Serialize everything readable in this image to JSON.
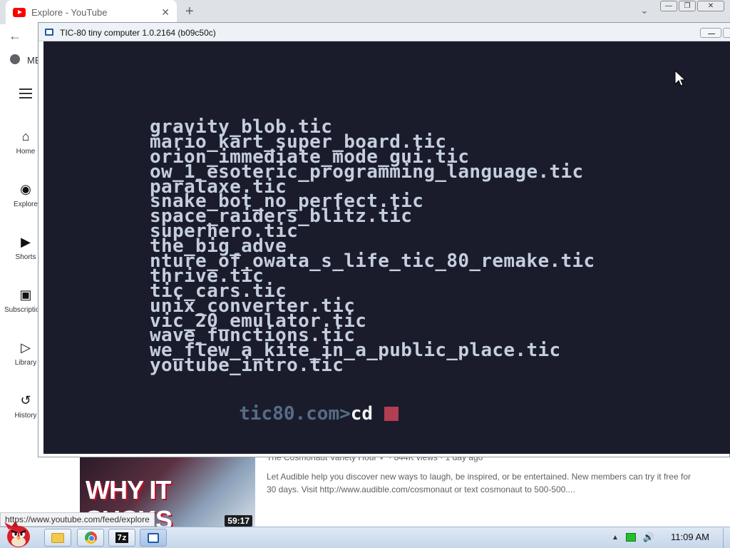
{
  "browser": {
    "tab_title": "Explore - YouTube",
    "tab_close": "✕",
    "new_tab": "+",
    "chevron": "⌄",
    "window_buttons": [
      "—",
      "❐",
      "✕"
    ],
    "back": "←",
    "mode_label": "ME"
  },
  "youtube": {
    "sidebar": [
      {
        "label": "Home",
        "icon": "⌂"
      },
      {
        "label": "Explore",
        "icon": "◉"
      },
      {
        "label": "Shorts",
        "icon": "▶"
      },
      {
        "label": "Subscriptions",
        "icon": "▣"
      },
      {
        "label": "Library",
        "icon": "▷"
      },
      {
        "label": "History",
        "icon": "↺"
      }
    ],
    "video": {
      "thumb_text": "WHY IT SUCKS",
      "duration": "59:17",
      "meta": "The Cosmonaut Variety Hour ✓ · 844K views · 1 day ago",
      "description": "Let Audible help you discover new ways to laugh, be inspired, or be entertained. New members can try it free for 30 days. Visit http://www.audible.com/cosmonaut or text cosmonaut to 500-500...."
    },
    "status_url": "https://www.youtube.com/feed/explore"
  },
  "tic": {
    "title": "TIC-80 tiny computer 1.0.2164 (b09c50c)",
    "files": [
      "gravity_blob.tic",
      "mario_kart_super_board.tic",
      "orion_immediate_mode_gui.tic",
      "ow_1_esoteric_programming_language.tic",
      "paralaxe.tic",
      "snake_bot_no_perfect.tic",
      "space_raiders_blitz.tic",
      "superhero.tic",
      "the_big_adve",
      "nture_of_owata_s_life_tic_80_remake.tic",
      "thrive.tic",
      "tic_cars.tic",
      "unix_converter.tic",
      "vic_20_emulator.tic",
      "wave_functions.tic",
      "we_flew_a_kite_in_a_public_place.tic",
      "youtube_intro.tic"
    ],
    "prompt": "tic80.com>",
    "command": "cd",
    "colors": {
      "background": "#1a1c2c",
      "text": "#c5cede",
      "prompt": "#566c86",
      "cursor": "#b13e53"
    }
  },
  "taskbar": {
    "time": "11:09 AM",
    "tray_up": "▲",
    "tray_volume": "🔊",
    "buttons": [
      "folder-icon",
      "chrome-icon",
      "7zip-icon",
      "tic80-icon"
    ],
    "seven_zip_label": "7z"
  }
}
